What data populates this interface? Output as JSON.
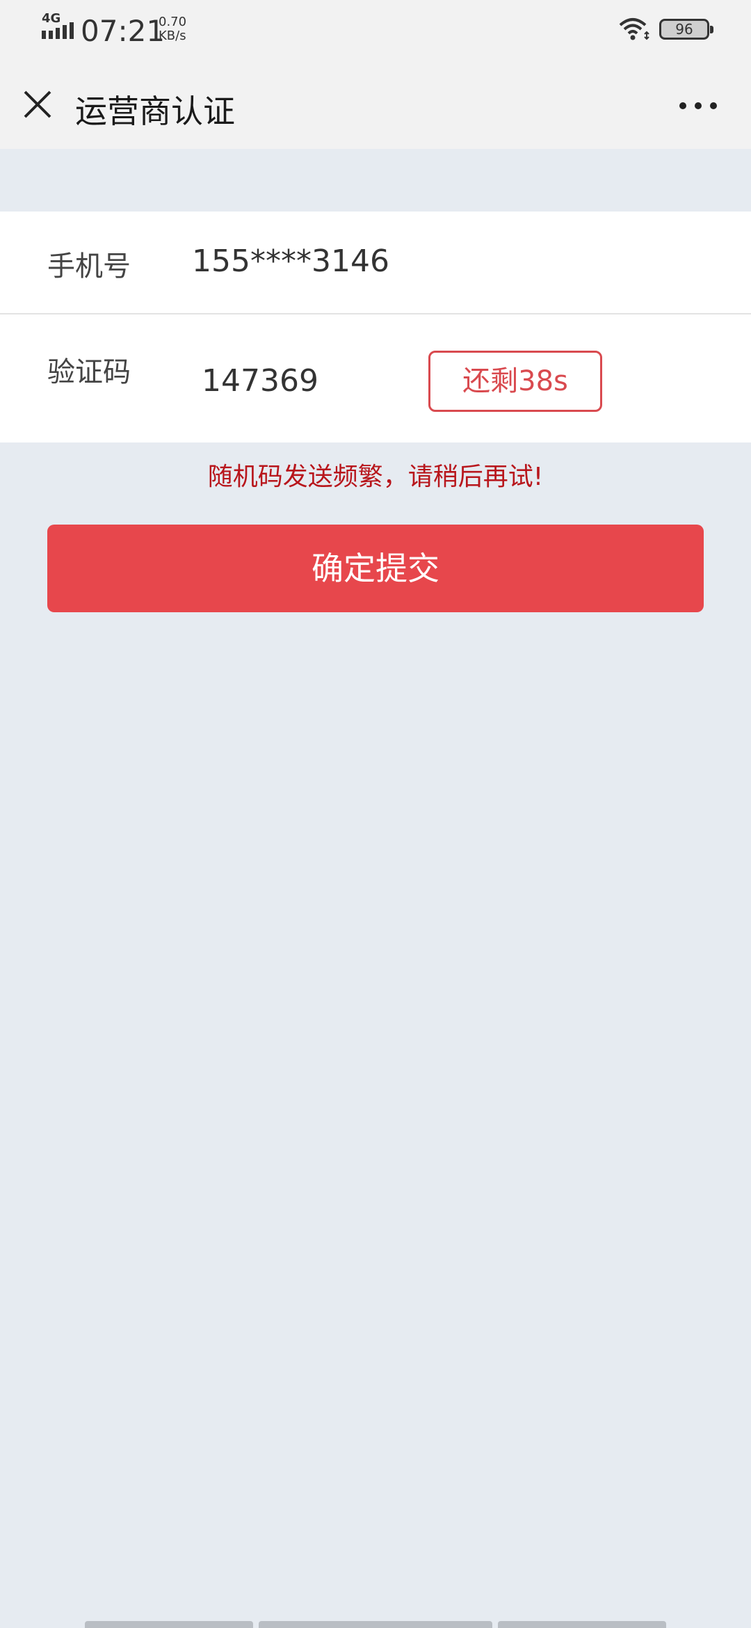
{
  "status_bar": {
    "network": "4G",
    "time": "07:21",
    "speed_value": "0.70",
    "speed_unit": "KB/s",
    "battery": "96"
  },
  "header": {
    "title": "运营商认证",
    "close_icon": "close-icon",
    "more_icon": "more-icon"
  },
  "form": {
    "phone_label": "手机号",
    "phone_value": "155****3146",
    "code_label": "验证码",
    "code_value": "147369",
    "countdown_label": "还剩38s"
  },
  "error_message": "随机码发送频繁，请稍后再试!",
  "submit_label": "确定提交",
  "colors": {
    "accent": "#e7474c",
    "error": "#b8161c",
    "background": "#e6ebf1"
  }
}
